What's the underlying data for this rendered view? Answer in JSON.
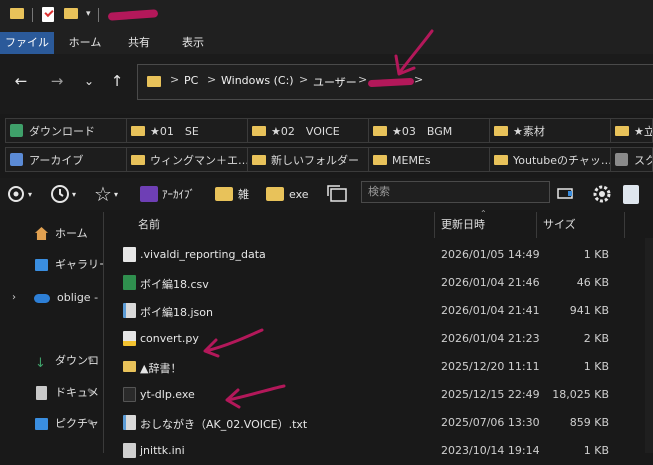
{
  "ribbon": {
    "tabs": [
      "ファイル",
      "ホーム",
      "共有",
      "表示"
    ]
  },
  "address": {
    "crumbs": [
      "PC",
      "Windows (C:)",
      "ユーザー"
    ],
    "separator": ">"
  },
  "quick_access": {
    "row1": [
      "ダウンロード",
      "★01　SE",
      "★02　VOICE",
      "★03　BGM",
      "★素材",
      "★立"
    ],
    "row2": [
      "アーカイブ",
      "ウィングマン＋エ…",
      "新しいフォルダー",
      "MEMEs",
      "Youtubeのチャッ…",
      "スク"
    ]
  },
  "toolbar": {
    "archive_label": "ｱｰｶｲﾌﾞ",
    "misc_label": "雑",
    "exe_label": "exe",
    "search_placeholder": "検索"
  },
  "sidebar": {
    "items": [
      {
        "label": "ホーム",
        "icon": "home-icon"
      },
      {
        "label": "ギャラリー",
        "icon": "gallery-icon"
      },
      {
        "label": "oblige - ",
        "icon": "cloud-icon"
      },
      {
        "label": "ダウンロ",
        "icon": "download-icon"
      },
      {
        "label": "ドキュメ",
        "icon": "document-icon"
      },
      {
        "label": "ピクチャ",
        "icon": "picture-icon"
      }
    ]
  },
  "columns": {
    "name": "名前",
    "date": "更新日時",
    "size": "サイズ"
  },
  "files": [
    {
      "name": ".vivaldi_reporting_data",
      "date": "2026/01/05 14:49",
      "size": "1 KB",
      "icon": "file-icon"
    },
    {
      "name": "ボイ編18.csv",
      "date": "2026/01/04 21:46",
      "size": "46 KB",
      "icon": "excel-file-icon"
    },
    {
      "name": "ボイ編18.json",
      "date": "2026/01/04 21:41",
      "size": "941 KB",
      "icon": "text-file-icon"
    },
    {
      "name": "convert.py",
      "date": "2026/01/04 21:23",
      "size": "2 KB",
      "icon": "python-file-icon"
    },
    {
      "name": "▲辞書！",
      "date": "2025/12/20 11:11",
      "size": "1 KB",
      "icon": "folder-shortcut-icon"
    },
    {
      "name": "yt-dlp.exe",
      "date": "2025/12/15 22:49",
      "size": "18,025 KB",
      "icon": "exe-file-icon"
    },
    {
      "name": "おしながき（AK_02.VOICE）.txt",
      "date": "2025/07/06 13:30",
      "size": "859 KB",
      "icon": "text-file-icon"
    },
    {
      "name": "jnittk.ini",
      "date": "2023/10/14 19:14",
      "size": "1 KB",
      "icon": "settings-file-icon"
    }
  ],
  "colors": {
    "accent_tab": "#2b5a9a",
    "folder": "#e8c25a",
    "annotation": "#b3185a",
    "background": "#191919"
  }
}
